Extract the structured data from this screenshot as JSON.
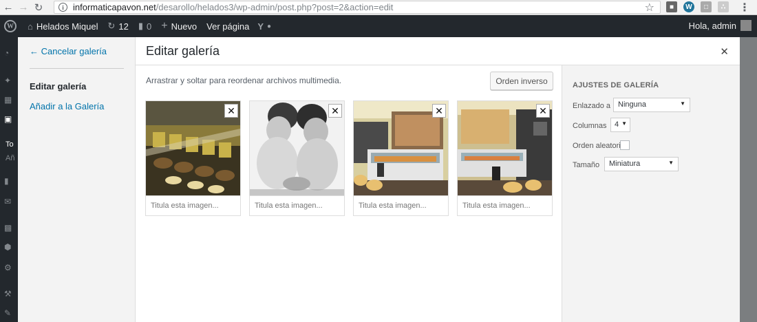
{
  "browser": {
    "url_host": "informaticapavon.net",
    "url_path": "/desarollo/helados3/wp-admin/post.php?post=2&action=edit"
  },
  "adminbar": {
    "site_name": "Helados Miquel",
    "updates_count": "12",
    "comments_count": "0",
    "new_label": "Nuevo",
    "view_label": "Ver página",
    "greeting": "Hola, admin"
  },
  "wp_menu_fragments": {
    "a": "To",
    "b": "Añ"
  },
  "modal": {
    "cancel_link": "← Cancelar galería",
    "edit_gallery": "Editar galería",
    "add_to_gallery": "Añadir a la Galería",
    "title": "Editar galería",
    "close_icon": "close-icon",
    "instructions": "Arrastrar y soltar para reordenar archivos multimedia.",
    "reverse_button": "Orden inverso",
    "attachments": [
      {
        "caption_placeholder": "Titula esta imagen..."
      },
      {
        "caption_placeholder": "Titula esta imagen..."
      },
      {
        "caption_placeholder": "Titula esta imagen..."
      },
      {
        "caption_placeholder": "Titula esta imagen..."
      }
    ]
  },
  "settings": {
    "title": "AJUSTES DE GALERÍA",
    "link_label": "Enlazado a",
    "link_value": "Ninguna",
    "columns_label": "Columnas",
    "columns_value": "4",
    "random_label": "Orden aleatorio",
    "random_checked": false,
    "size_label": "Tamaño",
    "size_value": "Miniatura"
  },
  "colors": {
    "link": "#0073aa",
    "adminbar": "#23282d"
  }
}
